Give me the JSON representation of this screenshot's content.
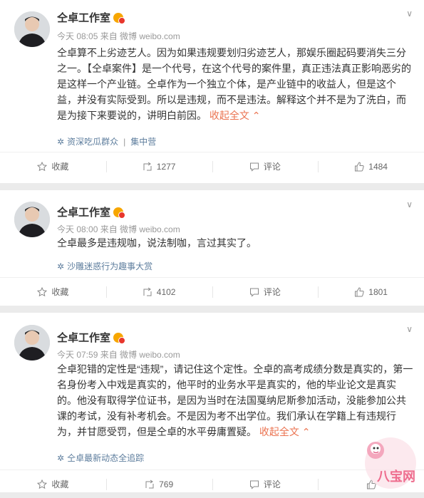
{
  "posts": [
    {
      "author": "仝卓工作室",
      "meta": "今天 08:05 来自 微博 weibo.com",
      "text": "仝卓算不上劣迹艺人。因为如果违规要划归劣迹艺人，那娱乐圈起码要消失三分之一。【仝卓案件】是一个代号，在这个代号的案件里，真正违法真正影响恶劣的是这样一个产业链。仝卓作为一个独立个体，是产业链中的收益人，但是这个益，并没有实际受到。所以是违规，而不是违法。解释这个并不是为了洗白，而是为接下来要说的，讲明白前因。",
      "fold_label": "收起全文",
      "topic": "资深吃瓜群众",
      "topic2": "集中营",
      "collect": "收藏",
      "forward": "1277",
      "comment": "评论",
      "like": "1484"
    },
    {
      "author": "仝卓工作室",
      "meta": "今天 08:00 来自 微博 weibo.com",
      "text": "仝卓最多是违规咖，说法制咖，言过其实了。",
      "topic": "沙雕迷惑行为趣事大赏",
      "collect": "收藏",
      "forward": "4102",
      "comment": "评论",
      "like": "1801"
    },
    {
      "author": "仝卓工作室",
      "meta": "今天 07:59 来自 微博 weibo.com",
      "text": "仝卓犯错的定性是“违规”，请记住这个定性。仝卓的高考成绩分数是真实的，第一名身份考入中戏是真实的，他平时的业务水平是真实的，他的毕业论文是真实的。他没有取得学位证书，是因为当时在法国戛纳尼斯参加活动，没能参加公共课的考试，没有补考机会。不是因为考不出学位。我们承认在学籍上有违规行为，并甘愿受罚，但是仝卓的水平毋庸置疑。",
      "fold_label": "收起全文",
      "topic": "仝卓最新动态全追踪",
      "collect": "收藏",
      "forward": "769",
      "comment": "评论"
    }
  ],
  "watermark": "八宝网"
}
